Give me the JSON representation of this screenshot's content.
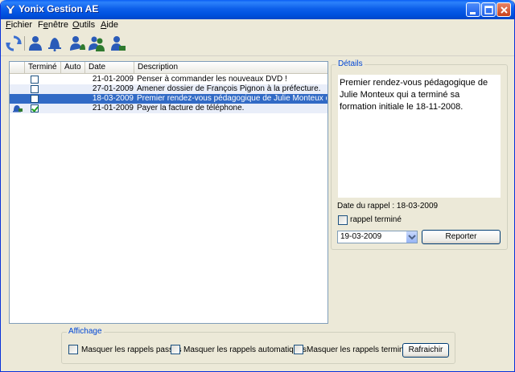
{
  "window": {
    "title": "Yonix Gestion AE"
  },
  "menu": [
    {
      "label": "Fichier",
      "accel": "F",
      "rest": "ichier"
    },
    {
      "label": "Fenêtre",
      "accel": "e",
      "pre": "F",
      "rest": "nêtre"
    },
    {
      "label": "Outils",
      "accel": "O",
      "rest": "utils"
    },
    {
      "label": "Aide",
      "accel": "A",
      "rest": "ide"
    }
  ],
  "toolbar": {
    "items": [
      "refresh-icon",
      "user-icon",
      "bell-icon",
      "user-bell-icon",
      "users-icon",
      "user-edit-icon"
    ]
  },
  "list": {
    "columns": [
      "",
      "Terminé",
      "Auto",
      "Date",
      "Description"
    ],
    "rows": [
      {
        "has_bell": false,
        "termine": false,
        "auto": "",
        "date": "21-01-2009",
        "description": "Penser à commander les nouveaux DVD !"
      },
      {
        "has_bell": false,
        "termine": false,
        "auto": "",
        "date": "27-01-2009",
        "description": "Amener dossier de François Pignon à la préfecture."
      },
      {
        "has_bell": false,
        "termine": false,
        "auto": "",
        "date": "18-03-2009",
        "description": "Premier rendez-vous pédagogique de Julie Monteux qui a t...",
        "selected": true
      },
      {
        "has_bell": true,
        "termine": true,
        "auto": "",
        "date": "21-01-2009",
        "description": "Payer la facture de téléphone."
      }
    ]
  },
  "details": {
    "group_title": "Détails",
    "text": "Premier rendez-vous pédagogique de Julie Monteux qui a terminé sa formation initiale le 18-11-2008.",
    "date_label": "Date du rappel : 18-03-2009",
    "rappel_termine_label": "rappel terminé",
    "combo_value": "19-03-2009",
    "reporter_label": "Reporter"
  },
  "affichage": {
    "group_title": "Affichage",
    "masquer_passes": "Masquer les rappels passés",
    "masquer_auto": "Masquer les rappels automatiques",
    "masquer_termines": "Masquer les rappels terminés",
    "rafraichir": "Rafraichir"
  },
  "colors": {
    "accent": "#316ac5",
    "title_text": "#0046d5"
  }
}
